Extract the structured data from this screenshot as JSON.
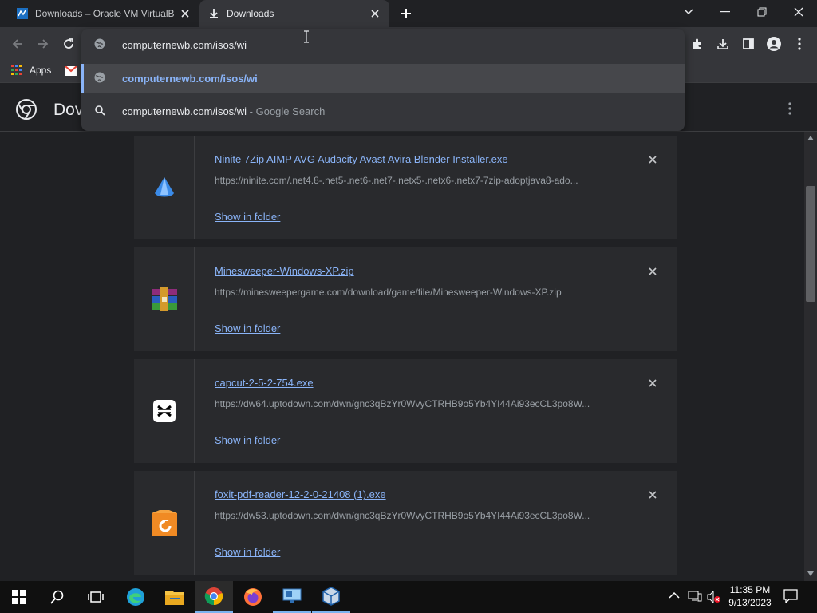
{
  "tabs": [
    {
      "title": "Downloads – Oracle VM VirtualB",
      "icon": "virtualbox-icon"
    },
    {
      "title": "Downloads",
      "icon": "download-icon"
    }
  ],
  "omnibox": {
    "typed_value": "computernewb.com/isos/wi",
    "suggestions": [
      {
        "text": "computernewb.com/isos/wi",
        "suffix": "",
        "icon": "globe-icon"
      },
      {
        "text": "computernewb.com/isos/wi",
        "suffix": " - Google Search",
        "icon": "search-icon"
      }
    ]
  },
  "bookmarks": {
    "apps_label": "Apps"
  },
  "page": {
    "title_partial": "Dov"
  },
  "downloads": [
    {
      "name": "Ninite 7Zip AIMP AVG Audacity Avast Avira Blender Installer.exe",
      "url": "https://ninite.com/.net4.8-.net5-.net6-.net7-.netx5-.netx6-.netx7-7zip-adoptjava8-ado...",
      "show_label": "Show in folder",
      "icon": "ninite-icon"
    },
    {
      "name": "Minesweeper-Windows-XP.zip",
      "url": "https://minesweepergame.com/download/game/file/Minesweeper-Windows-XP.zip",
      "show_label": "Show in folder",
      "icon": "winrar-icon"
    },
    {
      "name": "capcut-2-5-2-754.exe",
      "url": "https://dw64.uptodown.com/dwn/gnc3qBzYr0WvyCTRHB9o5Yb4YI44Ai93ecCL3po8W...",
      "show_label": "Show in folder",
      "icon": "capcut-icon"
    },
    {
      "name": "foxit-pdf-reader-12-2-0-21408 (1).exe",
      "url": "https://dw53.uptodown.com/dwn/gnc3qBzYr0WvyCTRHB9o5Yb4YI44Ai93ecCL3po8W...",
      "show_label": "Show in folder",
      "icon": "foxit-icon"
    }
  ],
  "taskbar": {
    "time": "11:35 PM",
    "date": "9/13/2023"
  },
  "colors": {
    "accent_link": "#8ab4f8",
    "tab_active": "#35363a",
    "background": "#202124",
    "card": "#292a2d"
  }
}
